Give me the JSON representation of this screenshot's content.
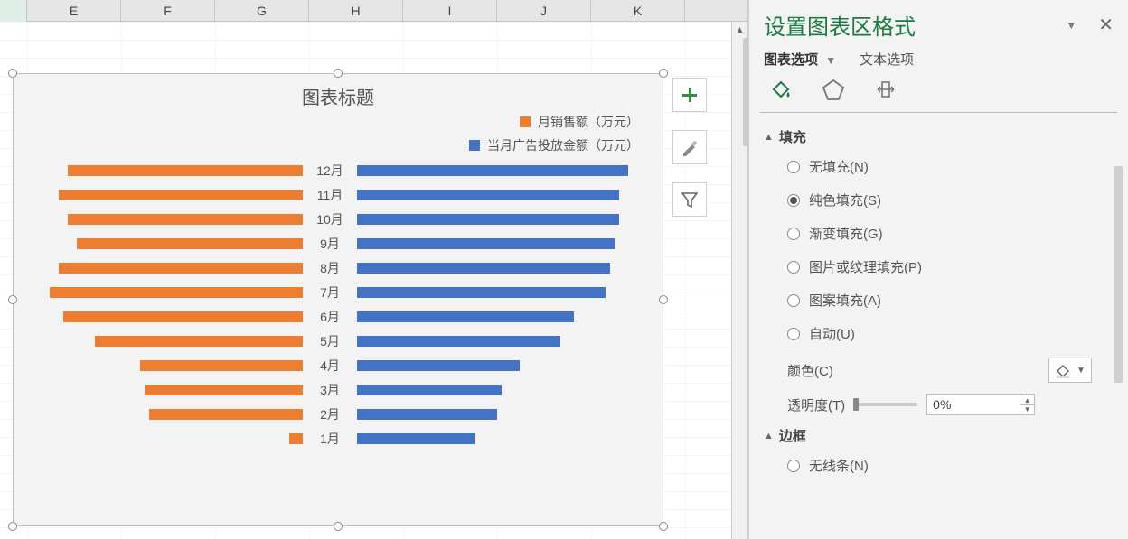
{
  "columns": [
    "E",
    "F",
    "G",
    "H",
    "I",
    "J",
    "K"
  ],
  "chart_title": "图表标题",
  "legend": {
    "series1_name": "月销售额（万元）",
    "series2_name": "当月广告投放金额（万元）"
  },
  "chart_data": {
    "type": "bar",
    "orientation": "horizontal-diverging",
    "categories": [
      "12月",
      "11月",
      "10月",
      "9月",
      "8月",
      "7月",
      "6月",
      "5月",
      "4月",
      "3月",
      "2月",
      "1月"
    ],
    "series": [
      {
        "name": "月销售额（万元）",
        "color": "#ED7D31",
        "values": [
          260,
          270,
          260,
          250,
          270,
          280,
          265,
          230,
          180,
          175,
          170,
          15
        ]
      },
      {
        "name": "当月广告投放金额（万元）",
        "color": "#4472C4",
        "values": [
          300,
          290,
          290,
          285,
          280,
          275,
          240,
          225,
          180,
          160,
          155,
          130
        ]
      }
    ],
    "title": "图表标题",
    "xlabel": "",
    "ylabel": "",
    "xlim_left": [
      -300,
      0
    ],
    "xlim_right": [
      0,
      300
    ]
  },
  "tools": {
    "add": "＋",
    "brush": "brush",
    "filter": "filter"
  },
  "pane": {
    "title": "设置图表区格式",
    "tab1": "图表选项",
    "tab2": "文本选项",
    "section_fill": "填充",
    "fill_none": "无填充(N)",
    "fill_solid": "纯色填充(S)",
    "fill_gradient": "渐变填充(G)",
    "fill_picture": "图片或纹理填充(P)",
    "fill_pattern": "图案填充(A)",
    "fill_auto": "自动(U)",
    "color_label": "颜色(C)",
    "transparency_label": "透明度(T)",
    "transparency_value": "0%",
    "section_border": "边框",
    "border_none": "无线条(N)"
  }
}
